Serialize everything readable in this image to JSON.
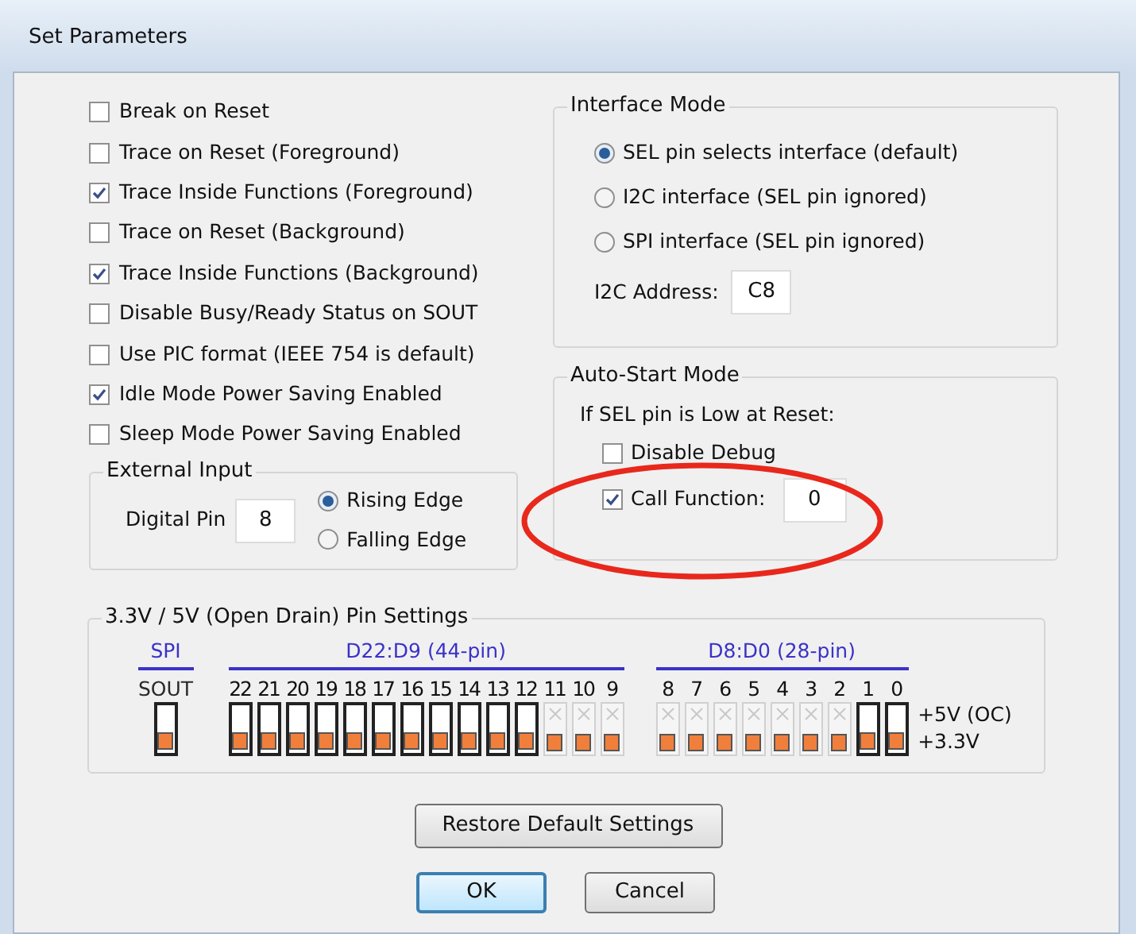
{
  "window": {
    "title": "Set Parameters"
  },
  "options": [
    {
      "label": "Break on Reset",
      "checked": false
    },
    {
      "label": "Trace on Reset (Foreground)",
      "checked": false
    },
    {
      "label": "Trace Inside Functions (Foreground)",
      "checked": true
    },
    {
      "label": "Trace on Reset (Background)",
      "checked": false
    },
    {
      "label": "Trace Inside Functions (Background)",
      "checked": true
    },
    {
      "label": "Disable Busy/Ready Status on SOUT",
      "checked": false
    },
    {
      "label": "Use PIC format (IEEE 754 is default)",
      "checked": false
    },
    {
      "label": "Idle Mode Power Saving Enabled",
      "checked": true
    },
    {
      "label": "Sleep Mode Power Saving Enabled",
      "checked": false
    }
  ],
  "external_input": {
    "title": "External Input",
    "pin_label": "Digital Pin",
    "pin_value": "8",
    "edges": [
      {
        "label": "Rising Edge",
        "selected": true
      },
      {
        "label": "Falling Edge",
        "selected": false
      }
    ]
  },
  "interface_mode": {
    "title": "Interface Mode",
    "options": [
      {
        "label": "SEL pin selects interface (default)",
        "selected": true
      },
      {
        "label": "I2C interface (SEL pin ignored)",
        "selected": false
      },
      {
        "label": "SPI interface (SEL pin ignored)",
        "selected": false
      }
    ],
    "address_label": "I2C Address:",
    "address_value": "C8"
  },
  "auto_start": {
    "title": "Auto-Start Mode",
    "note": "If SEL pin is Low at Reset:",
    "options": [
      {
        "label": "Disable Debug",
        "checked": false
      },
      {
        "label": "Call Function:",
        "checked": true
      }
    ],
    "function_value": "0",
    "highlighted": true
  },
  "pin_settings": {
    "title": "3.3V / 5V (Open Drain) Pin Settings",
    "groups": [
      {
        "title": "SPI",
        "pins": [
          {
            "label": "SOUT",
            "disabled": false
          }
        ]
      },
      {
        "title": "D22:D9 (44-pin)",
        "pins": [
          {
            "label": "22",
            "disabled": false
          },
          {
            "label": "21",
            "disabled": false
          },
          {
            "label": "20",
            "disabled": false
          },
          {
            "label": "19",
            "disabled": false
          },
          {
            "label": "18",
            "disabled": false
          },
          {
            "label": "17",
            "disabled": false
          },
          {
            "label": "16",
            "disabled": false
          },
          {
            "label": "15",
            "disabled": false
          },
          {
            "label": "14",
            "disabled": false
          },
          {
            "label": "13",
            "disabled": false
          },
          {
            "label": "12",
            "disabled": false
          },
          {
            "label": "11",
            "disabled": true
          },
          {
            "label": "10",
            "disabled": true
          },
          {
            "label": "9",
            "disabled": true
          }
        ]
      },
      {
        "title": "D8:D0 (28-pin)",
        "pins": [
          {
            "label": "8",
            "disabled": true
          },
          {
            "label": "7",
            "disabled": true
          },
          {
            "label": "6",
            "disabled": true
          },
          {
            "label": "5",
            "disabled": true
          },
          {
            "label": "4",
            "disabled": true
          },
          {
            "label": "3",
            "disabled": true
          },
          {
            "label": "2",
            "disabled": true
          },
          {
            "label": "1",
            "disabled": false
          },
          {
            "label": "0",
            "disabled": false
          }
        ]
      }
    ],
    "legend": [
      "+5V (OC)",
      "+3.3V"
    ]
  },
  "buttons": {
    "restore": "Restore Default Settings",
    "ok": "OK",
    "cancel": "Cancel"
  }
}
